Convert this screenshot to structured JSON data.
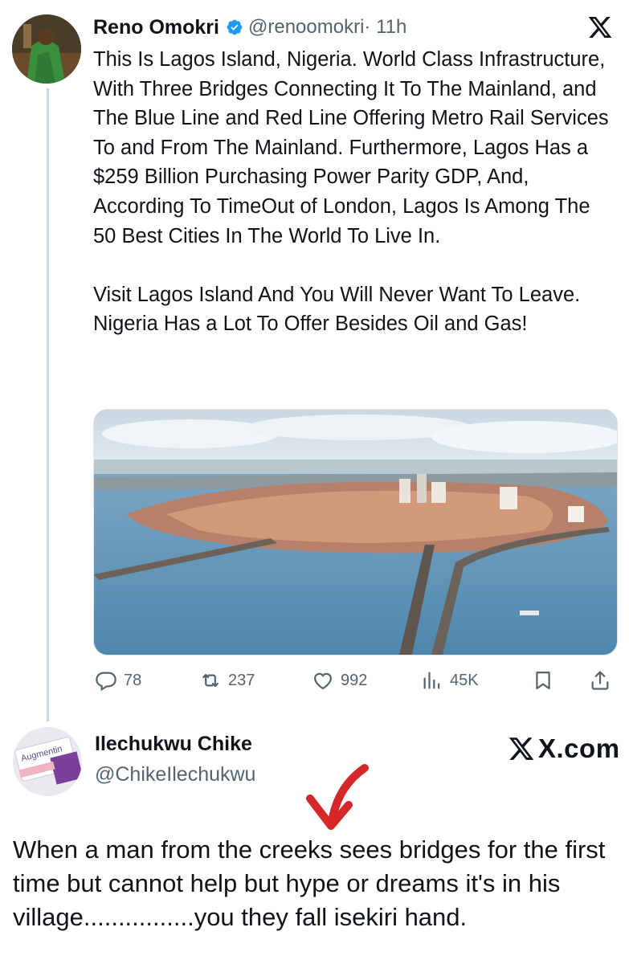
{
  "tweet": {
    "author_name": "Reno Omokri",
    "handle": "@renoomokri",
    "time": "· 11h",
    "text": "This Is Lagos Island, Nigeria. World Class Infrastructure, With Three Bridges Connecting It To The Mainland, and The Blue Line and Red Line Offering Metro Rail Services To and From The Mainland. Furthermore, Lagos Has a $259 Billion Purchasing Power Parity GDP, And, According To TimeOut of London, Lagos Is Among The 50 Best Cities In The World To Live In.\n\nVisit Lagos Island And You Will Never Want To Leave. Nigeria Has a Lot To Offer Besides Oil and Gas!",
    "media_icon": "aerial-photo-lagos-island",
    "stats": {
      "replies": "78",
      "reposts": "237",
      "likes": "992",
      "views": "45K"
    },
    "icons": {
      "verified": "verified-badge-icon",
      "platform": "x-logo-icon",
      "reply": "reply-icon",
      "repost": "repost-icon",
      "like": "heart-icon",
      "views": "views-icon",
      "bookmark": "bookmark-icon",
      "share": "share-icon"
    },
    "colors": {
      "verified_blue": "#1d9bf0",
      "secondary_text": "#536471",
      "primary_text": "#0f1419"
    }
  },
  "post": {
    "author_name": "Ilechukwu Chike",
    "handle": "@ChikeIlechukwu",
    "brand": "X.com",
    "avatar_text": "Augmentin",
    "caption": "When a man from the creeks sees bridges for the first time but cannot help but hype  or dreams it's in his village................you they fall isekiri hand.",
    "arrow_color": "#d62828"
  }
}
